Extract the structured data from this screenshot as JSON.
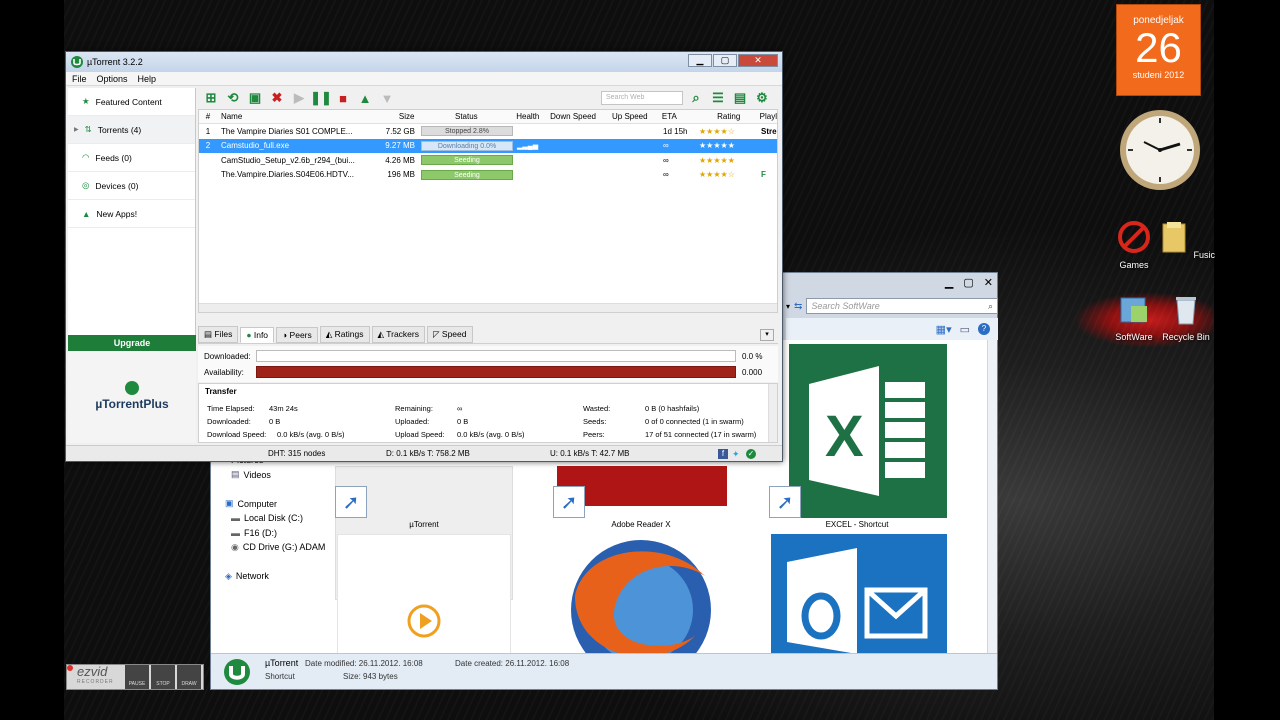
{
  "utorrent": {
    "title": "µTorrent 3.2.2",
    "menu": [
      "File",
      "Options",
      "Help"
    ],
    "sidebar": [
      {
        "label": "Featured Content",
        "icon": "star-icon"
      },
      {
        "label": "Torrents (4)",
        "icon": "torrents-icon"
      },
      {
        "label": "Feeds (0)",
        "icon": "rss-icon"
      },
      {
        "label": "Devices (0)",
        "icon": "device-icon"
      },
      {
        "label": "New Apps!",
        "icon": "apps-icon"
      }
    ],
    "upgrade_label": "Upgrade",
    "plus_label": "µTorrentPlus",
    "search_placeholder": "Search Web",
    "columns": [
      "#",
      "Name",
      "Size",
      "Status",
      "Health",
      "Down Speed",
      "Up Speed",
      "ETA",
      "Rating",
      "Playl"
    ],
    "torrents": [
      {
        "num": "1",
        "name": "The Vampire Diaries S01 COMPLE...",
        "size": "7.52 GB",
        "status": "Stopped 2.8%",
        "eta": "1d 15h",
        "rating": "★★★★☆",
        "play": "Stre"
      },
      {
        "num": "2",
        "name": "Camstudio_full.exe",
        "size": "9.27 MB",
        "status": "Downloading 0.0%",
        "eta": "∞",
        "rating": "★★★★★",
        "play": ""
      },
      {
        "num": "",
        "name": "CamStudio_Setup_v2.6b_r294_(bui...",
        "size": "4.26 MB",
        "status": "Seeding",
        "eta": "∞",
        "rating": "★★★★★",
        "play": ""
      },
      {
        "num": "",
        "name": "The.Vampire.Diaries.S04E06.HDTV...",
        "size": "196 MB",
        "status": "Seeding",
        "eta": "∞",
        "rating": "★★★★☆",
        "play": "F"
      }
    ],
    "tabs": [
      "Files",
      "Info",
      "Peers",
      "Ratings",
      "Trackers",
      "Speed"
    ],
    "info": {
      "downloaded_label": "Downloaded:",
      "downloaded_val": "0.0 %",
      "downloaded_fraction": 0.0,
      "availability_label": "Availability:",
      "availability_val": "0.000"
    },
    "transfer": {
      "heading": "Transfer",
      "time_elapsed_k": "Time Elapsed:",
      "time_elapsed_v": "43m 24s",
      "downloaded_k": "Downloaded:",
      "downloaded_v": "0 B",
      "dlspeed_k": "Download Speed:",
      "dlspeed_v": "0.0 kB/s (avg. 0 B/s)",
      "remaining_k": "Remaining:",
      "remaining_v": "∞",
      "uploaded_k": "Uploaded:",
      "uploaded_v": "0 B",
      "ulspeed_k": "Upload Speed:",
      "ulspeed_v": "0.0 kB/s (avg. 0 B/s)",
      "wasted_k": "Wasted:",
      "wasted_v": "0 B (0 hashfails)",
      "seeds_k": "Seeds:",
      "seeds_v": "0 of 0 connected (1 in swarm)",
      "peers_k": "Peers:",
      "peers_v": "17 of 51 connected (17 in swarm)"
    },
    "status": {
      "dht": "DHT: 315 nodes",
      "down": "D: 0.1 kB/s T: 758.2 MB",
      "up": "U: 0.1 kB/s T: 42.7 MB"
    }
  },
  "explorer": {
    "search_placeholder": "Search SoftWare",
    "nav": [
      "Pictures",
      "Videos",
      "",
      "Computer",
      "Local Disk (C:)",
      "F16 (D:)",
      "CD Drive (G:) ADAM",
      "",
      "Network"
    ],
    "tiles": [
      "µTorrent",
      "Adobe Reader X",
      "EXCEL - Shortcut"
    ],
    "details": {
      "name": "µTorrent",
      "type": "Shortcut",
      "modified": "Date modified: 26.11.2012. 16:08",
      "created": "Date created: 26.11.2012. 16:08",
      "size": "Size: 943 bytes"
    }
  },
  "calendar": {
    "dow": "ponedjeljak",
    "day": "26",
    "monthyear": "studeni 2012"
  },
  "desktop_icons": [
    "Games",
    "Fusic",
    "SoftWare",
    "Recycle Bin"
  ],
  "ezvid": {
    "logo": "ezvid",
    "sub": "RECORDER",
    "buttons": [
      "PAUSE",
      "STOP",
      "DRAW"
    ]
  },
  "colors": {
    "accent": "#3399ff",
    "upgrade": "#1f7d3a",
    "calendar": "#f26a1b",
    "availability": "#a0231a",
    "excel": "#1e7145",
    "outlook": "#1b72c0"
  }
}
